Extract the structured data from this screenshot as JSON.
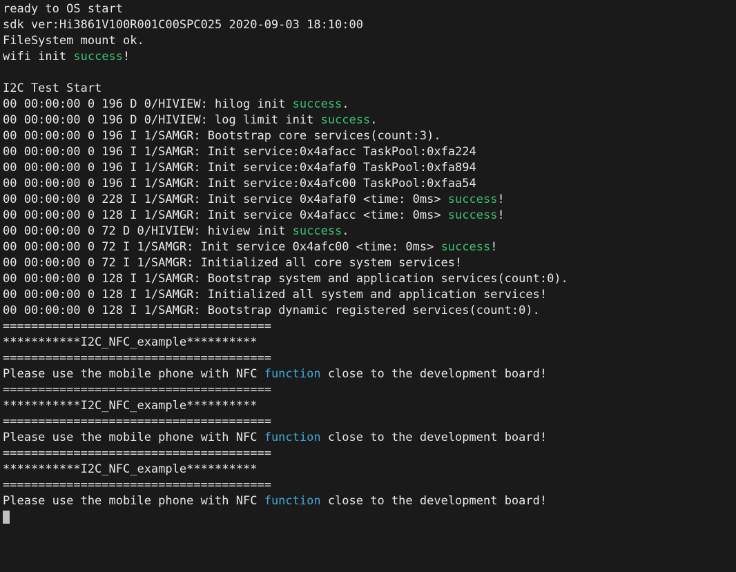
{
  "lines": [
    {
      "segments": [
        {
          "t": "ready to OS start"
        }
      ]
    },
    {
      "segments": [
        {
          "t": "sdk ver:Hi3861V100R001C00SPC025 2020-09-03 18:10:00"
        }
      ]
    },
    {
      "segments": [
        {
          "t": "FileSystem mount ok."
        }
      ]
    },
    {
      "segments": [
        {
          "t": "wifi init "
        },
        {
          "t": "success",
          "cls": "kw-success"
        },
        {
          "t": "!"
        }
      ]
    },
    {
      "segments": [
        {
          "t": ""
        }
      ]
    },
    {
      "segments": [
        {
          "t": "I2C Test Start"
        }
      ]
    },
    {
      "segments": [
        {
          "t": "00 00:00:00 0 196 D 0/HIVIEW: hilog init "
        },
        {
          "t": "success",
          "cls": "kw-success"
        },
        {
          "t": "."
        }
      ]
    },
    {
      "segments": [
        {
          "t": "00 00:00:00 0 196 D 0/HIVIEW: log limit init "
        },
        {
          "t": "success",
          "cls": "kw-success"
        },
        {
          "t": "."
        }
      ]
    },
    {
      "segments": [
        {
          "t": "00 00:00:00 0 196 I 1/SAMGR: Bootstrap core services(count:3)."
        }
      ]
    },
    {
      "segments": [
        {
          "t": "00 00:00:00 0 196 I 1/SAMGR: Init service:0x4afacc TaskPool:0xfa224"
        }
      ]
    },
    {
      "segments": [
        {
          "t": "00 00:00:00 0 196 I 1/SAMGR: Init service:0x4afaf0 TaskPool:0xfa894"
        }
      ]
    },
    {
      "segments": [
        {
          "t": "00 00:00:00 0 196 I 1/SAMGR: Init service:0x4afc00 TaskPool:0xfaa54"
        }
      ]
    },
    {
      "segments": [
        {
          "t": "00 00:00:00 0 228 I 1/SAMGR: Init service 0x4afaf0 <time: 0ms> "
        },
        {
          "t": "success",
          "cls": "kw-success"
        },
        {
          "t": "!"
        }
      ]
    },
    {
      "segments": [
        {
          "t": "00 00:00:00 0 128 I 1/SAMGR: Init service 0x4afacc <time: 0ms> "
        },
        {
          "t": "success",
          "cls": "kw-success"
        },
        {
          "t": "!"
        }
      ]
    },
    {
      "segments": [
        {
          "t": "00 00:00:00 0 72 D 0/HIVIEW: hiview init "
        },
        {
          "t": "success",
          "cls": "kw-success"
        },
        {
          "t": "."
        }
      ]
    },
    {
      "segments": [
        {
          "t": "00 00:00:00 0 72 I 1/SAMGR: Init service 0x4afc00 <time: 0ms> "
        },
        {
          "t": "success",
          "cls": "kw-success"
        },
        {
          "t": "!"
        }
      ]
    },
    {
      "segments": [
        {
          "t": "00 00:00:00 0 72 I 1/SAMGR: Initialized all core system services!"
        }
      ]
    },
    {
      "segments": [
        {
          "t": "00 00:00:00 0 128 I 1/SAMGR: Bootstrap system and application services(count:0)."
        }
      ]
    },
    {
      "segments": [
        {
          "t": "00 00:00:00 0 128 I 1/SAMGR: Initialized all system and application services!"
        }
      ]
    },
    {
      "segments": [
        {
          "t": "00 00:00:00 0 128 I 1/SAMGR: Bootstrap dynamic registered services(count:0)."
        }
      ]
    },
    {
      "segments": [
        {
          "t": "======================================"
        }
      ]
    },
    {
      "segments": [
        {
          "t": "***********I2C_NFC_example**********"
        }
      ]
    },
    {
      "segments": [
        {
          "t": "======================================"
        }
      ]
    },
    {
      "segments": [
        {
          "t": "Please use the mobile phone with NFC "
        },
        {
          "t": "function",
          "cls": "kw-function"
        },
        {
          "t": " close to the development board!"
        }
      ]
    },
    {
      "segments": [
        {
          "t": "======================================"
        }
      ]
    },
    {
      "segments": [
        {
          "t": "***********I2C_NFC_example**********"
        }
      ]
    },
    {
      "segments": [
        {
          "t": "======================================"
        }
      ]
    },
    {
      "segments": [
        {
          "t": "Please use the mobile phone with NFC "
        },
        {
          "t": "function",
          "cls": "kw-function"
        },
        {
          "t": " close to the development board!"
        }
      ]
    },
    {
      "segments": [
        {
          "t": "======================================"
        }
      ]
    },
    {
      "segments": [
        {
          "t": "***********I2C_NFC_example**********"
        }
      ]
    },
    {
      "segments": [
        {
          "t": "======================================"
        }
      ]
    },
    {
      "segments": [
        {
          "t": "Please use the mobile phone with NFC "
        },
        {
          "t": "function",
          "cls": "kw-function"
        },
        {
          "t": " close to the development board!"
        }
      ]
    }
  ]
}
